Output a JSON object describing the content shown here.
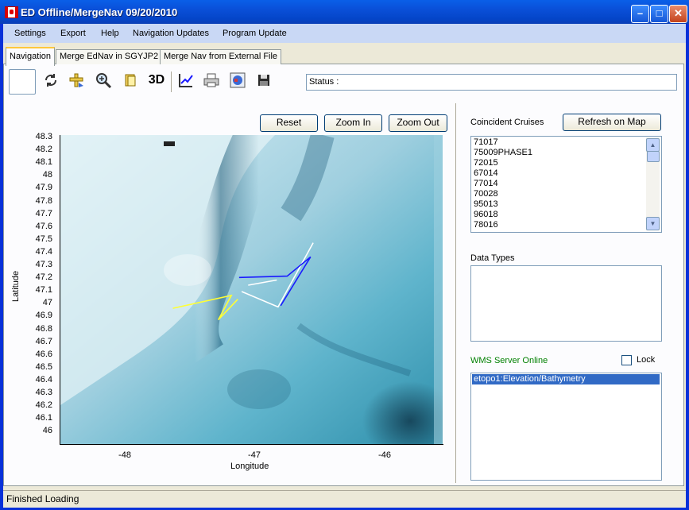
{
  "window": {
    "title": "ED Offline/MergeNav 09/20/2010"
  },
  "menu": [
    "Settings",
    "Export",
    "Help",
    "Navigation Updates",
    "Program Update"
  ],
  "tabs": [
    "Navigation",
    "Merge EdNav in SGYJP2",
    "Merge Nav from External File"
  ],
  "toolbar": {
    "icons": [
      "refresh-icon",
      "pan-icon",
      "zoom-icon",
      "layer-icon",
      "3d-icon",
      "chart-icon",
      "print-icon",
      "globe-icon",
      "save-icon"
    ],
    "three_d_label": "3D",
    "status_label": "Status :"
  },
  "map": {
    "buttons": {
      "reset": "Reset",
      "zoom_in": "Zoom In",
      "zoom_out": "Zoom Out"
    },
    "ylabel": "Latitude",
    "xlabel": "Longitude",
    "yticks": [
      "48.3",
      "48.2",
      "48.1",
      "48",
      "47.9",
      "47.8",
      "47.7",
      "47.6",
      "47.5",
      "47.4",
      "47.3",
      "47.2",
      "47.1",
      "47",
      "46.9",
      "46.8",
      "46.7",
      "46.6",
      "46.5",
      "46.4",
      "46.3",
      "46.2",
      "46.1",
      "46"
    ],
    "xticks": [
      "-48",
      "-47",
      "-46"
    ],
    "tracks": [
      {
        "color": "#ffff33",
        "points": [
          [
            -47.63,
            46.97
          ],
          [
            -47.18,
            47.07
          ],
          [
            -47.28,
            46.88
          ],
          [
            -47.13,
            47.04
          ]
        ]
      },
      {
        "color": "#ffffff",
        "points": [
          [
            -47.1,
            47.1
          ],
          [
            -46.82,
            46.98
          ],
          [
            -46.55,
            47.48
          ]
        ]
      },
      {
        "color": "#ffffff",
        "points": [
          [
            -47.05,
            47.15
          ],
          [
            -46.83,
            47.19
          ]
        ]
      },
      {
        "color": "#1a1aff",
        "points": [
          [
            -47.12,
            47.21
          ],
          [
            -46.75,
            47.22
          ],
          [
            -46.57,
            47.37
          ],
          [
            -46.8,
            46.99
          ]
        ]
      }
    ]
  },
  "coincident": {
    "label": "Coincident Cruises",
    "refresh": "Refresh on Map",
    "cruises": [
      "71017",
      "75009PHASE1",
      "72015",
      "67014",
      "77014",
      "70028",
      "95013",
      "96018",
      "78016"
    ]
  },
  "data_types": {
    "label": "Data Types"
  },
  "wms": {
    "label": "WMS Server Online",
    "label_color": "#008000",
    "lock": "Lock",
    "layers": [
      "etopo1:Elevation/Bathymetry"
    ]
  },
  "status_bar": {
    "text": "Finished Loading"
  }
}
